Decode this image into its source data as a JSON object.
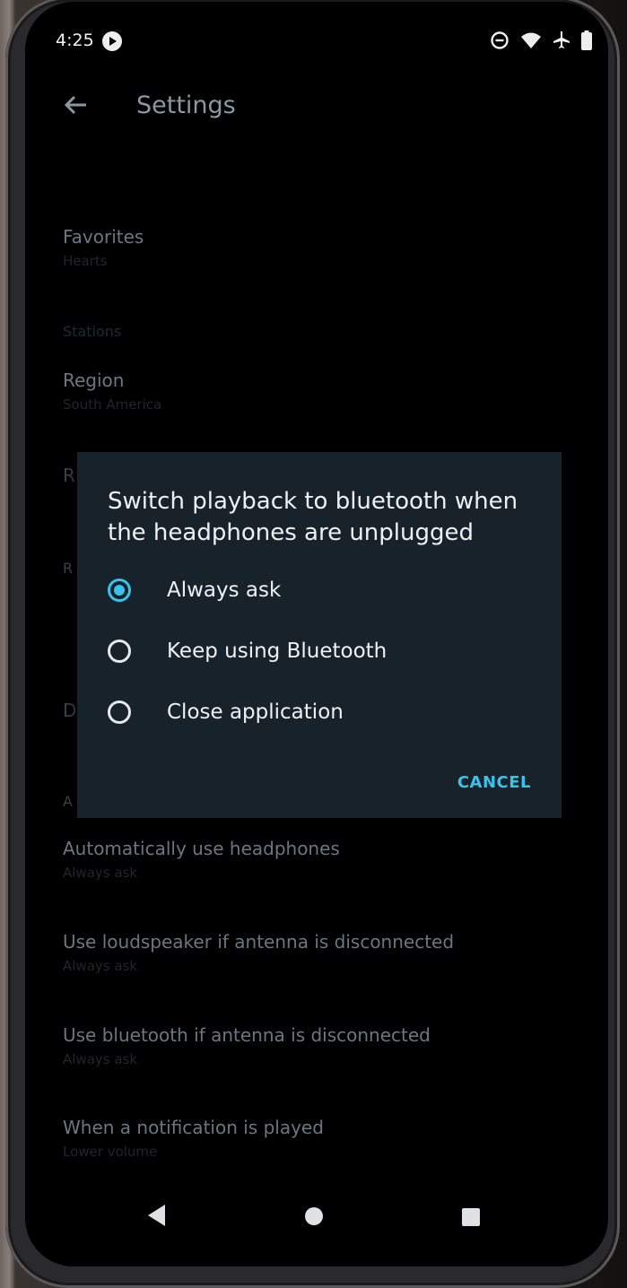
{
  "status_bar": {
    "time": "4:25"
  },
  "app_bar": {
    "title": "Settings"
  },
  "settings": {
    "favorites": {
      "title": "Favorites",
      "summary": "Hearts"
    },
    "stations_category": "Stations",
    "region": {
      "title": "Region",
      "summary": "South America"
    },
    "automatically_use_headphones": {
      "title": "Automatically use headphones",
      "summary": "Always ask"
    },
    "use_loudspeaker": {
      "title": "Use loudspeaker if antenna is disconnected",
      "summary": "Always ask"
    },
    "use_bluetooth": {
      "title": "Use bluetooth if antenna is disconnected",
      "summary": "Always ask"
    },
    "notification": {
      "title": "When a notification is played",
      "summary": "Lower volume"
    }
  },
  "dialog": {
    "title": "Switch playback to bluetooth when the headphones are unplugged",
    "options": [
      {
        "label": "Always ask",
        "checked": true
      },
      {
        "label": "Keep using Bluetooth",
        "checked": false
      },
      {
        "label": "Close application",
        "checked": false
      }
    ],
    "cancel_label": "CANCEL"
  },
  "colors": {
    "accent": "#39c3ec",
    "dialog_bg": "#18222a"
  }
}
